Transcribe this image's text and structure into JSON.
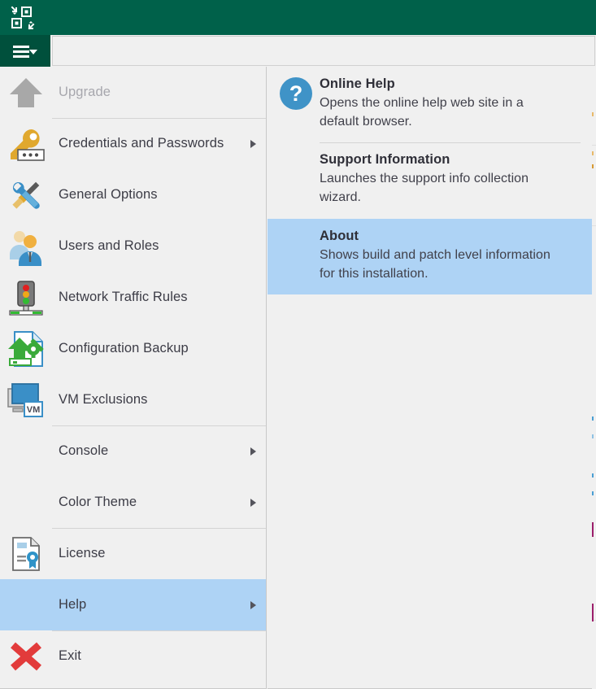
{
  "window": {
    "app_icon": "veeam-logo-icon",
    "titlebar_color": "#00614a",
    "menu_button_color": "#00503c",
    "menu_button_icon": "hamburger-menu-icon",
    "ribbon_field_value": ""
  },
  "main_menu": {
    "items": [
      {
        "id": "upgrade",
        "label": "Upgrade",
        "icon": "upgrade-arrow-icon",
        "disabled": true,
        "has_submenu": false,
        "selected": false,
        "separator_above": false
      },
      {
        "id": "credentials",
        "label": "Credentials and Passwords",
        "icon": "key-password-icon",
        "disabled": false,
        "has_submenu": true,
        "selected": false,
        "separator_above": true
      },
      {
        "id": "general-options",
        "label": "General Options",
        "icon": "wrench-screwdriver-icon",
        "disabled": false,
        "has_submenu": false,
        "selected": false,
        "separator_above": false
      },
      {
        "id": "users-and-roles",
        "label": "Users and Roles",
        "icon": "users-group-icon",
        "disabled": false,
        "has_submenu": false,
        "selected": false,
        "separator_above": false
      },
      {
        "id": "network-traffic",
        "label": "Network Traffic Rules",
        "icon": "traffic-light-icon",
        "disabled": false,
        "has_submenu": false,
        "selected": false,
        "separator_above": false
      },
      {
        "id": "config-backup",
        "label": "Configuration Backup",
        "icon": "config-backup-icon",
        "disabled": false,
        "has_submenu": false,
        "selected": false,
        "separator_above": false
      },
      {
        "id": "vm-exclusions",
        "label": "VM Exclusions",
        "icon": "vm-monitor-icon",
        "disabled": false,
        "has_submenu": false,
        "selected": false,
        "separator_above": false
      },
      {
        "id": "console",
        "label": "Console",
        "icon": "none",
        "disabled": false,
        "has_submenu": true,
        "selected": false,
        "separator_above": true
      },
      {
        "id": "color-theme",
        "label": "Color Theme",
        "icon": "none",
        "disabled": false,
        "has_submenu": true,
        "selected": false,
        "separator_above": false
      },
      {
        "id": "license",
        "label": "License",
        "icon": "license-certificate-icon",
        "disabled": false,
        "has_submenu": false,
        "selected": false,
        "separator_above": true
      },
      {
        "id": "help",
        "label": "Help",
        "icon": "none",
        "disabled": false,
        "has_submenu": true,
        "selected": true,
        "separator_above": false
      },
      {
        "id": "exit",
        "label": "Exit",
        "icon": "red-x-exit-icon",
        "disabled": false,
        "has_submenu": false,
        "selected": false,
        "separator_above": true
      }
    ],
    "selection_color": "#aed3f5"
  },
  "submenu": {
    "parent": "Help",
    "items": [
      {
        "id": "online-help",
        "title": "Online Help",
        "description": "Opens the online help web site in a default browser.",
        "icon": "question-mark-circle-icon",
        "selected": false,
        "separator_above": false
      },
      {
        "id": "support-information",
        "title": "Support Information",
        "description": "Launches the support info collection wizard.",
        "icon": "none",
        "selected": false,
        "separator_above": true
      },
      {
        "id": "about",
        "title": "About",
        "description": "Shows build and patch level information for this installation.",
        "icon": "none",
        "selected": true,
        "separator_above": false
      }
    ]
  }
}
